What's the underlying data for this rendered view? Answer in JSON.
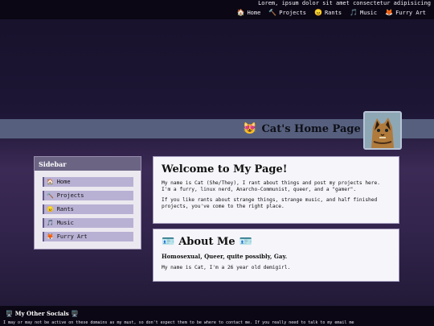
{
  "top": {
    "marquee": "Lorem, ipsum dolor sit amet consectetur adipisicing",
    "nav": [
      {
        "label": "Home",
        "icon": "🏠"
      },
      {
        "label": "Projects",
        "icon": "🔨"
      },
      {
        "label": "Rants",
        "icon": "😠"
      },
      {
        "label": "Music",
        "icon": "🎵"
      },
      {
        "label": "Furry Art",
        "icon": "🦊"
      }
    ]
  },
  "header": {
    "title": "Cat's Home Page",
    "left_emoji": "😻",
    "right_emoji": "😻"
  },
  "sidebar": {
    "title": "Sidebar",
    "items": [
      {
        "label": "Home",
        "icon": "🏠"
      },
      {
        "label": "Projects",
        "icon": "🔨"
      },
      {
        "label": "Rants",
        "icon": "😠"
      },
      {
        "label": "Music",
        "icon": "🎵"
      },
      {
        "label": "Furry Art",
        "icon": "🦊"
      }
    ]
  },
  "welcome": {
    "heading": "Welcome to My Page!",
    "p1": "My name is Cat (She/They), I rant about things and post my projects here. I'm a furry, linux nerd, Anarcho-Communist, queer, and a \"gamer\".",
    "p2": "If you like rants about strange things, strange music, and half finished projects, you've come to the right place."
  },
  "about": {
    "heading": "About Me",
    "icon": "🪪",
    "subheading": "Homosexual, Queer, quite possibly, Gay.",
    "p1": "My name is Cat, I'm a 26 year old demigirl."
  },
  "footer": {
    "title": "My Other Socials",
    "icon": "🖥️",
    "text": "I may or may not be active on these domains as my must, so don't expect them to be where to contact me. If you really need to talk to my email me"
  }
}
